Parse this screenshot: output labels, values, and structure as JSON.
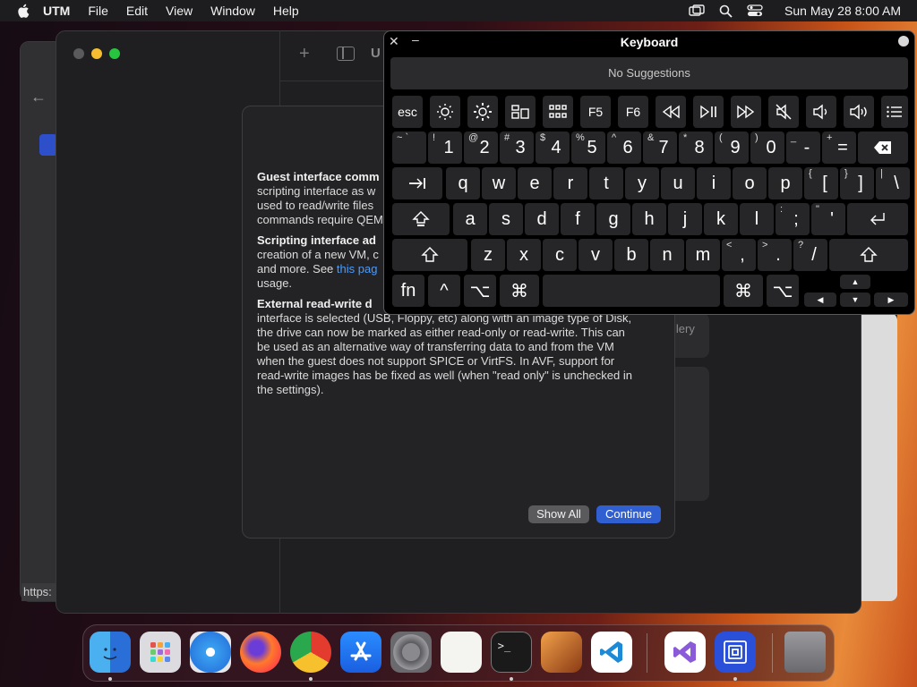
{
  "menubar": {
    "app_name": "UTM",
    "items": [
      "File",
      "Edit",
      "View",
      "Window",
      "Help"
    ],
    "clock": "Sun May 28  8:00 AM"
  },
  "status_url": "https:",
  "dialog": {
    "p1_bold": "Guest interface comm",
    "p1_rest": "scripting interface as w used to read/write files commands require QEM",
    "p1_lines": [
      "scripting interface as w",
      "used to read/write files",
      "commands require QEM"
    ],
    "p2_bold": "Scripting interface ad",
    "p2_lines": [
      "creation of a new VM, c"
    ],
    "p2_line3_pre": "and more. See ",
    "p2_link": "this pag",
    "p2_line4": "usage.",
    "p3_bold": "External read-write d",
    "p3_lines": [
      "interface is selected (USB, Floppy, etc) along with an image type of Disk,",
      "the drive can now be marked as either read-only or read-write. This can",
      "be used as an alternative way of transferring data to and from the VM",
      "when the guest does not support SPICE or VirtFS. In AVF, support for",
      "read-write images has be fixed as well (when \"read only\" is unchecked in",
      "the settings)."
    ],
    "show_all": "Show All",
    "continue": "Continue"
  },
  "gallery_fragment": "llery",
  "keyboard": {
    "title": "Keyboard",
    "suggestions": "No Suggestions",
    "esc": "esc",
    "f5": "F5",
    "f6": "F6",
    "fn": "fn",
    "ctrl": "^",
    "opt": "⌥",
    "cmd": "⌘",
    "num_row": [
      {
        "sub": "~",
        "sub2": "`",
        "main": ""
      },
      {
        "sub": "!",
        "main": "1"
      },
      {
        "sub": "@",
        "main": "2"
      },
      {
        "sub": "#",
        "main": "3"
      },
      {
        "sub": "$",
        "main": "4"
      },
      {
        "sub": "%",
        "main": "5"
      },
      {
        "sub": "^",
        "main": "6"
      },
      {
        "sub": "&",
        "main": "7"
      },
      {
        "sub": "*",
        "main": "8"
      },
      {
        "sub": "(",
        "main": "9"
      },
      {
        "sub": ")",
        "main": "0"
      },
      {
        "sub": "_",
        "main": "-"
      },
      {
        "sub": "+",
        "main": "="
      }
    ],
    "row_q": [
      "q",
      "w",
      "e",
      "r",
      "t",
      "y",
      "u",
      "i",
      "o",
      "p"
    ],
    "row_q_extra": [
      {
        "sub": "{",
        "main": "["
      },
      {
        "sub": "}",
        "main": "]"
      },
      {
        "sub": "|",
        "main": "\\"
      }
    ],
    "row_a": [
      "a",
      "s",
      "d",
      "f",
      "g",
      "h",
      "j",
      "k",
      "l"
    ],
    "row_a_extra": [
      {
        "sub": ":",
        "main": ";"
      },
      {
        "sub": "\"",
        "main": "'"
      }
    ],
    "row_z": [
      "z",
      "x",
      "c",
      "v",
      "b",
      "n",
      "m"
    ],
    "row_z_extra": [
      {
        "sub": "<",
        "main": ","
      },
      {
        "sub": ">",
        "main": "."
      },
      {
        "sub": "?",
        "main": "/"
      }
    ]
  },
  "dock": {
    "apps": [
      "Finder",
      "Launchpad",
      "Safari",
      "Firefox",
      "Chrome",
      "App Store",
      "System Settings",
      "TextEdit",
      "Terminal",
      "GarageBand",
      "VS Code",
      "Visual Studio",
      "UTM",
      "Trash"
    ]
  }
}
